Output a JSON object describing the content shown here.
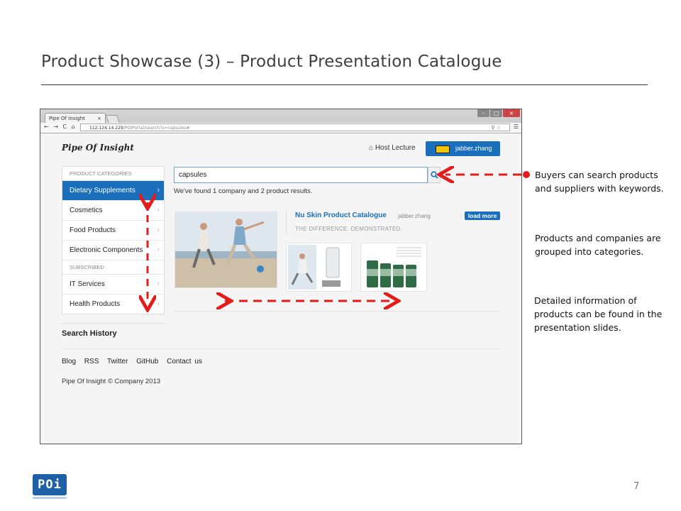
{
  "slide": {
    "title": "Product Showcase (3) – Product Presentation Catalogue",
    "page_number": "7",
    "logo_text": "POi"
  },
  "browser": {
    "tab_title": "Pipe Of Insight",
    "tab_close": "×",
    "url_host": "112.124.14.229",
    "url_path": "/POIPortal/search?s=capsules#",
    "nav_glyphs": "← → C ⌂"
  },
  "site": {
    "brand": "Pipe Of Insight",
    "host_lecture": "Host Lecture",
    "user_name": "jabber.zhang"
  },
  "sidebar": {
    "categories_heading": "PRODUCT CATEGORIES",
    "categories": [
      {
        "label": "Dietary Supplements",
        "active": true
      },
      {
        "label": "Cosmetics"
      },
      {
        "label": "Food Products"
      },
      {
        "label": "Electronic Components"
      }
    ],
    "subscribed_heading": "SUBSCRIBED",
    "subscribed": [
      {
        "label": "IT Services"
      },
      {
        "label": "Health Products"
      }
    ],
    "search_history": "Search History"
  },
  "search": {
    "value": "capsules",
    "results_text": "We've found 1 company and 2 product results."
  },
  "result": {
    "title": "Nu Skin Product Catalogue",
    "user": "jabber.zhang",
    "load_more": "load more",
    "tagline": "THE DIFFERENCE. DEMONSTRATED."
  },
  "footer": {
    "links": [
      "Blog",
      "RSS",
      "Twitter",
      "GitHub",
      "Contact us"
    ],
    "copyright": "Pipe Of Insight © Company 2013"
  },
  "annotations": {
    "search_note": [
      "Buyers can search products",
      "and suppliers with keywords."
    ],
    "category_note": [
      "Products and companies are",
      "grouped into categories."
    ],
    "slides_note": [
      "Detailed information of",
      "products can be found in the",
      "presentation slides."
    ]
  },
  "colors": {
    "accent": "#1a6fbd",
    "annotation_red": "#e31b1b"
  }
}
